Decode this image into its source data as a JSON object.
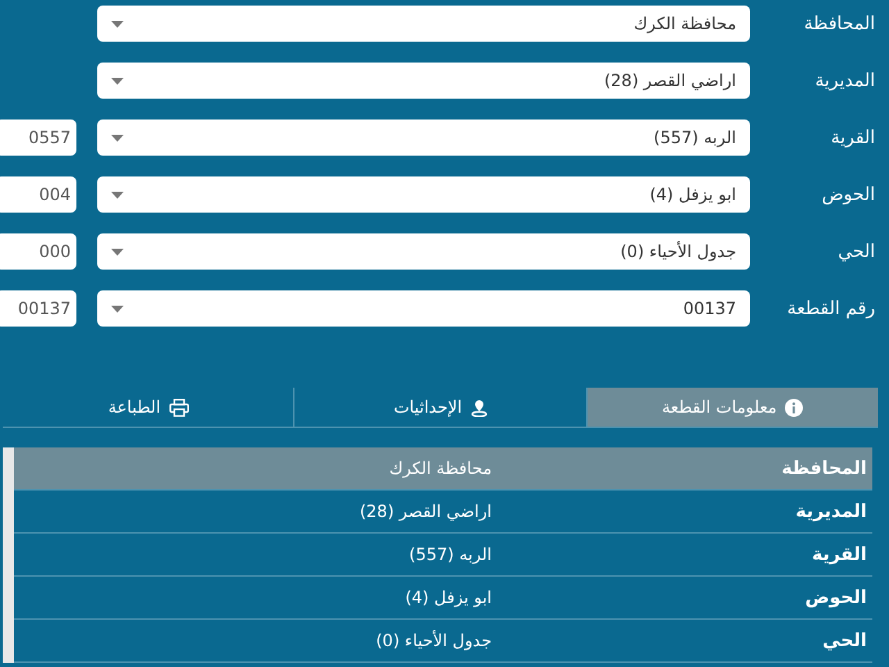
{
  "form": [
    {
      "label": "المحافظة",
      "value": "محافظة الكرك"
    },
    {
      "label": "المديرية",
      "value": "اراضي القصر (28)"
    },
    {
      "label": "القرية",
      "value": "الربه (557)",
      "code": "0557"
    },
    {
      "label": "الحوض",
      "value": "ابو يزفل (4)",
      "code": "004"
    },
    {
      "label": "الحي",
      "value": "جدول الأحياء (0)",
      "code": "000"
    },
    {
      "label": "رقم القطعة",
      "value": "00137",
      "code": "00137"
    }
  ],
  "tabs": [
    {
      "label": "معلومات القطعة",
      "kind": "info",
      "selected": true
    },
    {
      "label": "الإحداثيات",
      "kind": "location",
      "selected": false
    },
    {
      "label": "الطباعة",
      "kind": "print",
      "selected": false
    }
  ],
  "info_rows": [
    {
      "label": "المحافظة",
      "value": "محافظة الكرك",
      "selected": true
    },
    {
      "label": "المديرية",
      "value": "اراضي القصر (28)",
      "selected": false
    },
    {
      "label": "القرية",
      "value": "الربه (557)",
      "selected": false
    },
    {
      "label": "الحوض",
      "value": "ابو يزفل (4)",
      "selected": false
    },
    {
      "label": "الحي",
      "value": "جدول الأحياء (0)",
      "selected": false
    }
  ]
}
